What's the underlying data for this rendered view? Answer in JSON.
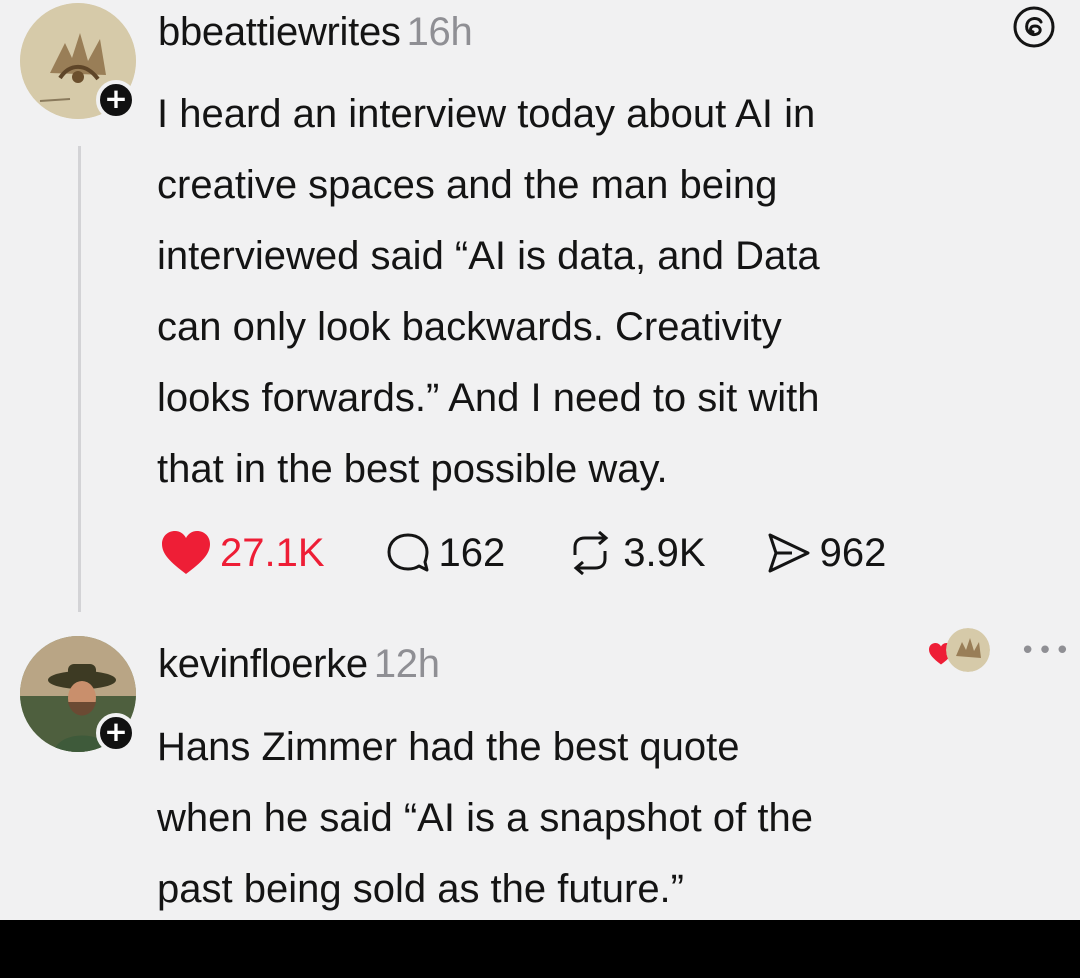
{
  "post": {
    "username": "bbeattiewrites",
    "time": "16h",
    "follow_glyph": "+",
    "text_lines": [
      "I heard an interview today about AI in",
      "creative spaces and the man being",
      "interviewed said “AI is data, and Data",
      "can only look backwards. Creativity",
      "looks forwards.” And I need to sit with",
      "that in the best possible way."
    ],
    "stats": {
      "likes": "27.1K",
      "replies": "162",
      "reposts": "3.9K",
      "shares": "962"
    },
    "icons": [
      "heart-icon",
      "comment-icon",
      "repost-icon",
      "share-icon",
      "threads-logo-icon"
    ]
  },
  "reply": {
    "username": "kevinfloerke",
    "time": "12h",
    "follow_glyph": "+",
    "more_glyph": "•••",
    "text_lines": [
      "Hans Zimmer had the best quote",
      "when he said “AI is a snapshot of the",
      "past being sold as the future.”"
    ],
    "icons": [
      "liked-by-author-heart-icon",
      "author-mini-avatar",
      "more-options-icon"
    ]
  },
  "colors": {
    "background": "#f1f1f2",
    "text": "#141414",
    "muted": "#8f8f94",
    "like_red": "#ee1e36",
    "thread_line": "#d3d3d6"
  }
}
